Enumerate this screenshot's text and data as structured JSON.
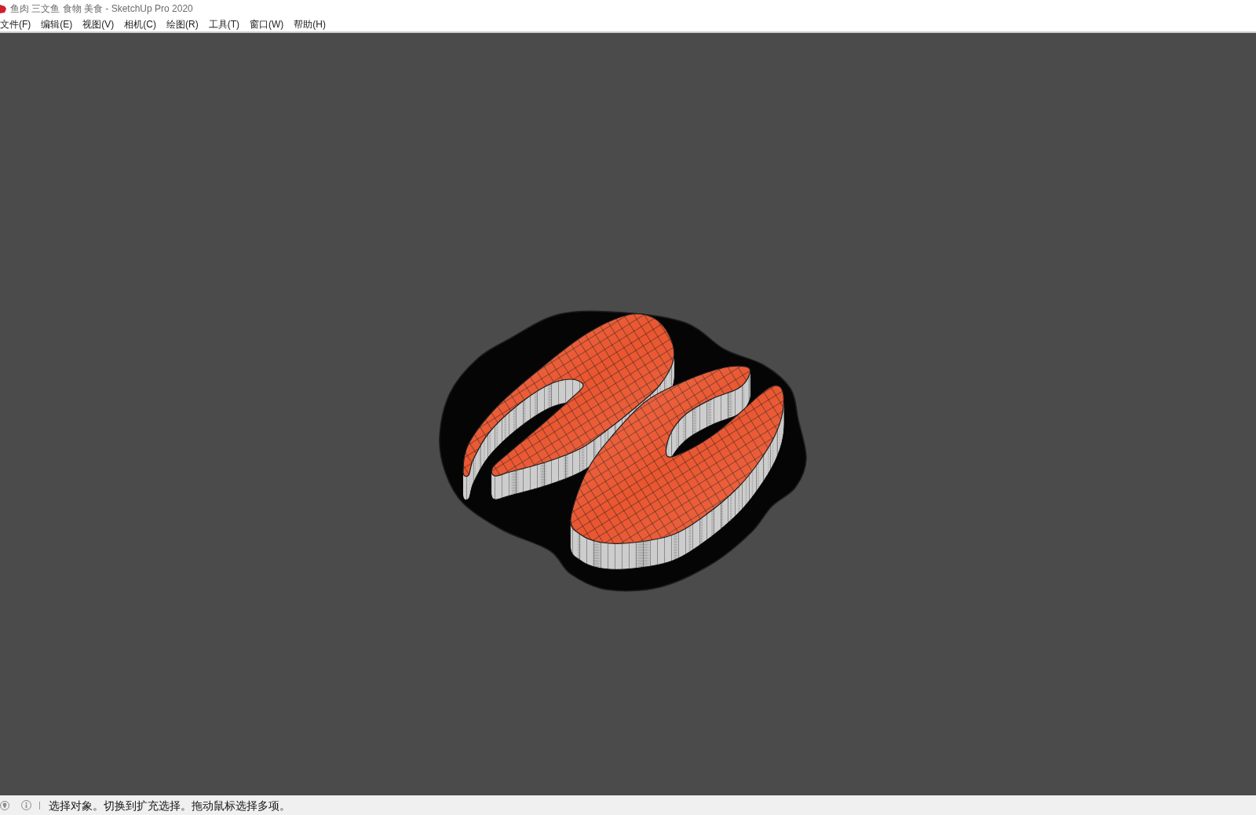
{
  "window": {
    "title": "鱼肉 三文鱼 食物 美食 - SketchUp Pro 2020"
  },
  "menu_bar": {
    "items": [
      "文件(F)",
      "编辑(E)",
      "视图(V)",
      "相机(C)",
      "绘图(R)",
      "工具(T)",
      "窗口(W)",
      "帮助(H)"
    ]
  },
  "status_bar": {
    "message": "选择对象。切换到扩充选择。拖动鼠标选择多项。"
  }
}
